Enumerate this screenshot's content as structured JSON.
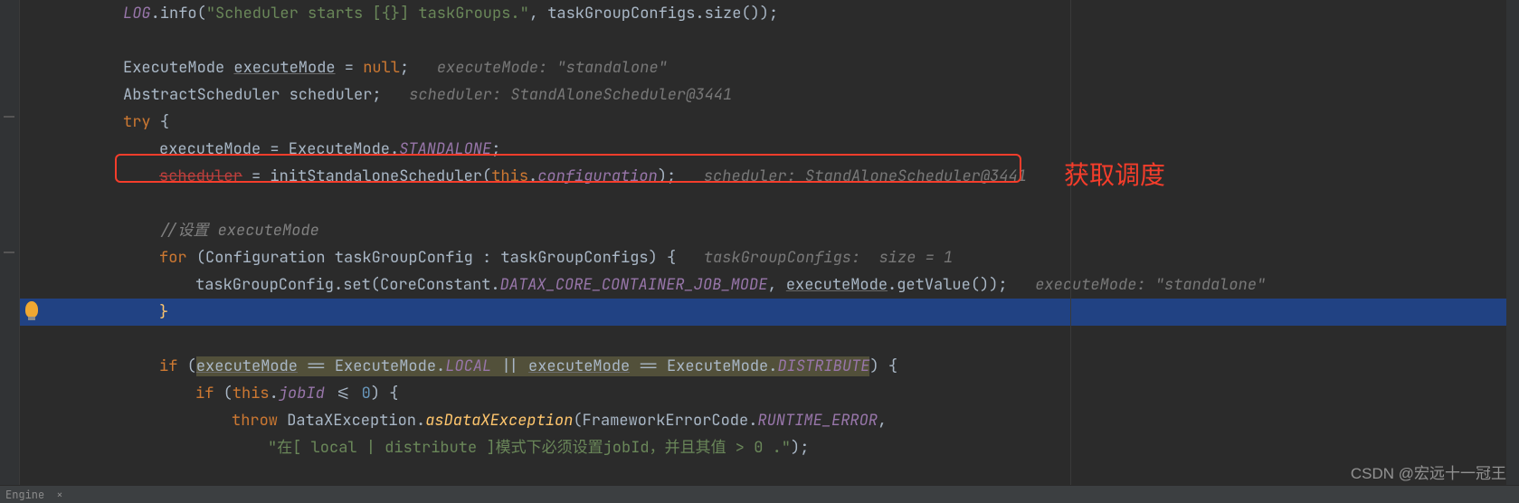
{
  "annotation": "获取调度",
  "watermark": "CSDN @宏远十一冠王",
  "status": {
    "label": "Engine",
    "close": "×"
  },
  "code": {
    "l1": {
      "a": "LOG",
      "b": ".info(",
      "c": "\"Scheduler starts [{}] taskGroups.\"",
      "d": ", taskGroupConfigs.size());"
    },
    "l3": {
      "a": "ExecuteMode ",
      "b": "executeMode",
      "c": " = ",
      "d": "null",
      "e": ";   ",
      "hint": "executeMode: \"standalone\""
    },
    "l4": {
      "a": "AbstractScheduler scheduler;   ",
      "hint": "scheduler: StandAloneScheduler@3441"
    },
    "l5": {
      "a": "try ",
      "b": "{"
    },
    "l6": {
      "a": "executeMode = ExecuteMode.",
      "b": "STANDALONE",
      "c": ";"
    },
    "l7": {
      "a": "scheduler",
      "b": " = initStandaloneScheduler(",
      "c": "this",
      "d": ".",
      "e": "configuration",
      "f": ");   ",
      "hint": "scheduler: StandAloneScheduler@3441"
    },
    "l9": {
      "a": "//设置 executeMode"
    },
    "l10": {
      "a": "for ",
      "b": "(Configuration taskGroupConfig : taskGroupConfigs) {   ",
      "hint": "taskGroupConfigs:  size = 1"
    },
    "l11": {
      "a": "taskGroupConfig.set(CoreConstant.",
      "b": "DATAX_CORE_CONTAINER_JOB_MODE",
      "c": ", ",
      "d": "executeMode",
      "e": ".getValue());   ",
      "hint": "executeMode: \"standalone\""
    },
    "l12": {
      "a": "}"
    },
    "l14": {
      "a": "if ",
      "b": "(",
      "c": "executeMode",
      "d": " == ExecuteMode.",
      "e": "LOCAL",
      "f": " || ",
      "g": "executeMode",
      "h": " == ExecuteMode.",
      "i": "DISTRIBUTE",
      "j": ") {"
    },
    "l15": {
      "a": "if ",
      "b": "(",
      "c": "this",
      "d": ".",
      "e": "jobId",
      "f": " <= ",
      "g": "0",
      "h": ") {"
    },
    "l16": {
      "a": "throw ",
      "b": "DataXException.",
      "c": "asDataXException",
      "d": "(FrameworkErrorCode.",
      "e": "RUNTIME_ERROR",
      "f": ","
    },
    "l17": {
      "a": "\"在[ local | distribute ]模式下必须设置jobId，并且其值 > 0 .\"",
      "b": ");"
    }
  }
}
